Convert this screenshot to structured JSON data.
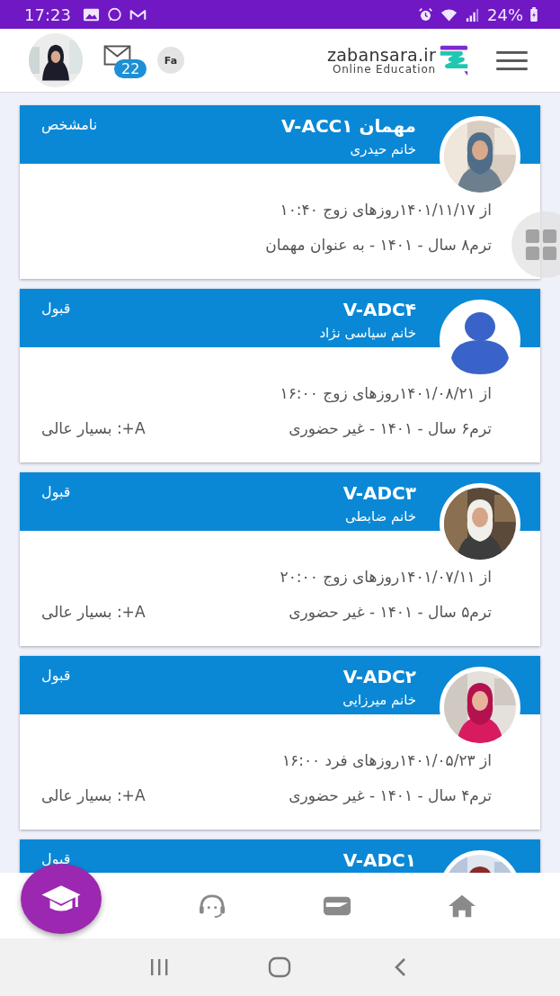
{
  "status_bar": {
    "time": "17:23",
    "battery": "24%"
  },
  "header": {
    "mail_count": "22",
    "language": "Fa",
    "logo_name": "zabansara.ir",
    "logo_tagline": "Online Education"
  },
  "classes": [
    {
      "title": "مهمان V-ACC۱",
      "teacher": "خانم حیدری",
      "status": "نامشخص",
      "schedule": "از ۱۴۰۱/۱۱/۱۷روزهای زوج ۱۰:۴۰",
      "term": "ترم۸ سال - ۱۴۰۱ - به عنوان مهمان"
    },
    {
      "title": "V-ADC۴",
      "teacher": "خانم سیاسی نژاد",
      "status": "قبول",
      "avatar": {
        "kind": "placeholder"
      },
      "schedule": "از ۱۴۰۱/۰۸/۲۱روزهای زوج ۱۶:۰۰",
      "term": "ترم۶ سال - ۱۴۰۱ - غیر حضوری",
      "grade": "A+: بسیار عالی"
    },
    {
      "title": "V-ADC۳",
      "teacher": "خانم ضابطی",
      "status": "قبول",
      "schedule": "از ۱۴۰۱/۰۷/۱۱روزهای زوج ۲۰:۰۰",
      "term": "ترم۵ سال - ۱۴۰۱ - غیر حضوری",
      "grade": "A+: بسیار عالی"
    },
    {
      "title": "V-ADC۲",
      "teacher": "خانم میرزایی",
      "status": "قبول",
      "schedule": "از ۱۴۰۱/۰۵/۲۳روزهای فرد ۱۶:۰۰",
      "term": "ترم۴ سال - ۱۴۰۱ - غیر حضوری",
      "grade": "A+: بسیار عالی"
    },
    {
      "title": "V-ADC۱",
      "status": "قبول"
    }
  ]
}
